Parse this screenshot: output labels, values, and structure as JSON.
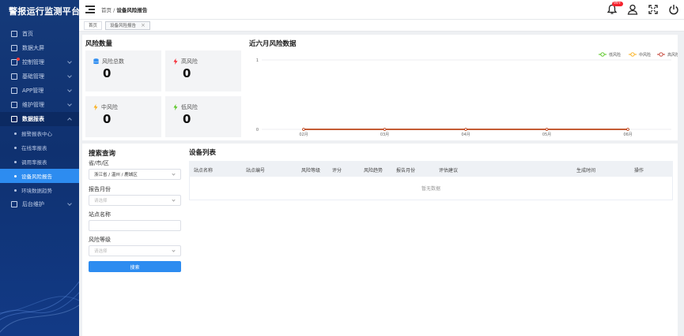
{
  "app": {
    "title": "警报运行监测平台"
  },
  "sidebar": {
    "items": [
      {
        "label": "首页"
      },
      {
        "label": "数据大屏"
      },
      {
        "label": "控制管理"
      },
      {
        "label": "基础管理"
      },
      {
        "label": "APP管理"
      },
      {
        "label": "维护管理"
      },
      {
        "label": "数据报表"
      },
      {
        "label": "后台维护"
      }
    ],
    "sub_items": [
      {
        "label": "报警报表中心"
      },
      {
        "label": "在线率报表"
      },
      {
        "label": "调用率报表"
      },
      {
        "label": "设备风险报告"
      },
      {
        "label": "环境数据趋势"
      }
    ]
  },
  "header": {
    "breadcrumb_home": "首页",
    "breadcrumb_sep": " / ",
    "breadcrumb_current": "设备风险报告",
    "notification_badge": "99+"
  },
  "tabs": [
    {
      "label": "首页"
    },
    {
      "label": "设备风险报告"
    }
  ],
  "risk": {
    "title": "风险数量",
    "cards": [
      {
        "label": "风险总数",
        "value": "0",
        "icon": "database-icon",
        "color": "#2d8cf0"
      },
      {
        "label": "高风险",
        "value": "0",
        "icon": "bolt-icon",
        "color": "#f5222d"
      },
      {
        "label": "中风险",
        "value": "0",
        "icon": "bolt-icon",
        "color": "#faad14"
      },
      {
        "label": "低风险",
        "value": "0",
        "icon": "bolt-icon",
        "color": "#52c41a"
      }
    ]
  },
  "chart_data": {
    "type": "line",
    "title": "近六月风险数据",
    "categories": [
      "02月",
      "03月",
      "04月",
      "05月",
      "06月"
    ],
    "series": [
      {
        "name": "低风险",
        "values": [
          0,
          0,
          0,
          0,
          0
        ],
        "color": "#52c41a"
      },
      {
        "name": "中风险",
        "values": [
          0,
          0,
          0,
          0,
          0
        ],
        "color": "#faad14"
      },
      {
        "name": "高风险",
        "values": [
          0,
          0,
          0,
          0,
          0
        ],
        "color": "#c0392b"
      }
    ],
    "ylim": [
      0,
      1
    ],
    "yticks": [
      0,
      1
    ],
    "legend": "top-right",
    "grid": true
  },
  "search": {
    "title": "搜索查询",
    "region_label": "省/市/区",
    "region_value": "浙江省 / 温州 / 鹿城区",
    "month_label": "报告月份",
    "month_placeholder": "请选择",
    "station_label": "站点名称",
    "level_label": "风险等级",
    "level_placeholder": "请选择",
    "button_label": "搜索"
  },
  "list": {
    "title": "设备列表",
    "columns": [
      "站点名称",
      "站点编号",
      "风险等级",
      "评分",
      "风险趋势",
      "报告月份",
      "评估建议",
      "生成时间",
      "操作"
    ],
    "empty_text": "暂无数据"
  }
}
